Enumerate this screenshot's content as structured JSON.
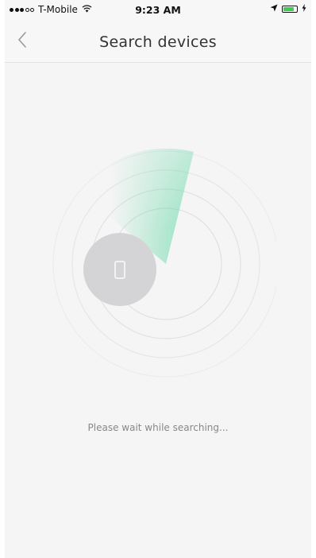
{
  "status_bar": {
    "carrier": "T-Mobile",
    "time": "9:23 AM",
    "signal_strength": 3,
    "signal_max": 5,
    "battery_level": 0.8,
    "icons": [
      "wifi-icon",
      "location-arrow-icon",
      "battery-icon",
      "charging-icon"
    ]
  },
  "nav": {
    "title": "Search devices",
    "back_icon": "chevron-left-icon"
  },
  "main": {
    "message": "Please wait while searching...",
    "device_icon": "phone-icon",
    "radar_sweep_color": "#5cd6a3"
  },
  "colors": {
    "background": "#f5f5f5",
    "device_circle": "#d4d4d6",
    "radar_ring": "#e6e6e6"
  }
}
